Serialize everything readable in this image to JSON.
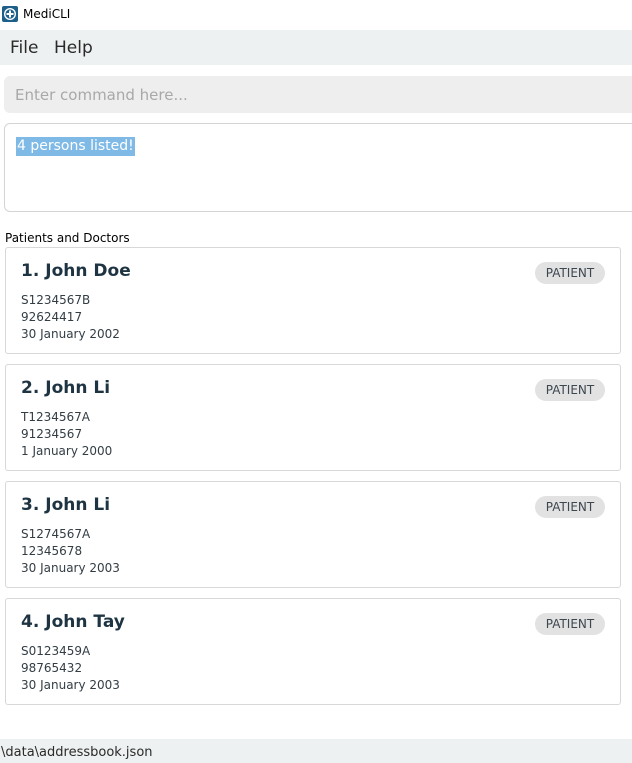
{
  "window": {
    "title": "MediCLI"
  },
  "menu": {
    "file": "File",
    "help": "Help"
  },
  "command": {
    "placeholder": "Enter command here...",
    "value": ""
  },
  "result": {
    "message": "4 persons listed!"
  },
  "list": {
    "label": "Patients and Doctors",
    "persons": [
      {
        "index": "1.",
        "name": "John Doe",
        "nric": "S1234567B",
        "phone": "92624417",
        "dob": "30 January 2002",
        "type": "PATIENT"
      },
      {
        "index": "2.",
        "name": "John Li",
        "nric": "T1234567A",
        "phone": "91234567",
        "dob": "1 January 2000",
        "type": "PATIENT"
      },
      {
        "index": "3.",
        "name": "John Li",
        "nric": "S1274567A",
        "phone": "12345678",
        "dob": "30 January 2003",
        "type": "PATIENT"
      },
      {
        "index": "4.",
        "name": "John Tay",
        "nric": "S0123459A",
        "phone": "98765432",
        "dob": "30 January 2003",
        "type": "PATIENT"
      }
    ]
  },
  "status": {
    "path": "\\data\\addressbook.json"
  },
  "colors": {
    "accent": "#7fb9e6",
    "badge": "#e2e2e2",
    "name": "#1e3442"
  },
  "icons": {
    "app": "medical-cross-icon"
  }
}
